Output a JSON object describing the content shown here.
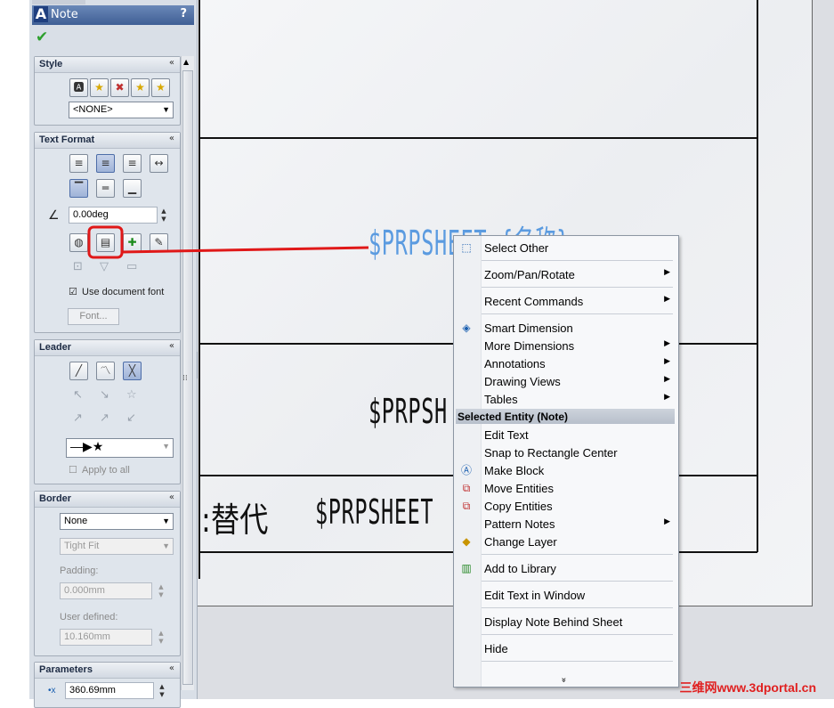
{
  "panel": {
    "title": "Note",
    "help": "?",
    "ok_glyph": "✔",
    "style": {
      "header": "Style",
      "collapse": "«",
      "select_value": "<NONE>"
    },
    "text_format": {
      "header": "Text Format",
      "collapse": "«",
      "angle_value": "0.00deg",
      "use_doc_font_label": "Use document font",
      "use_doc_font_checked": true,
      "font_button": "Font..."
    },
    "leader": {
      "header": "Leader",
      "collapse": "«",
      "apply_all_label": "Apply to all",
      "apply_all_checked": false
    },
    "border": {
      "header": "Border",
      "collapse": "«",
      "style_value": "None",
      "size_value": "Tight Fit",
      "padding_label": "Padding:",
      "padding_value": "0.000mm",
      "user_defined_label": "User defined:",
      "user_defined_value": "10.160mm"
    },
    "parameters": {
      "header": "Parameters",
      "collapse": "«",
      "x_value": "360.69mm"
    }
  },
  "drawing": {
    "note_selected": "$PRPSHEET {名称}",
    "note_mid": "$PRPSH",
    "note_bottom_left": ":替代",
    "note_bottom_right": "$PRPSHEET"
  },
  "menu": {
    "items_top": [
      {
        "label": "Select Other",
        "icon": "select-other-icon",
        "submenu": false
      },
      {
        "label": "Zoom/Pan/Rotate",
        "submenu": true
      },
      {
        "label": "Recent Commands",
        "submenu": true
      },
      {
        "label": "Smart Dimension",
        "icon": "smart-dimension-icon",
        "submenu": false
      },
      {
        "label": "More Dimensions",
        "submenu": true
      },
      {
        "label": "Annotations",
        "submenu": true
      },
      {
        "label": "Drawing Views",
        "submenu": true
      },
      {
        "label": "Tables",
        "submenu": true
      }
    ],
    "section_header": "Selected Entity (Note)",
    "items_entity": [
      {
        "label": "Edit Text",
        "submenu": false
      },
      {
        "label": "Snap to Rectangle Center",
        "submenu": false
      },
      {
        "label": "Make Block",
        "icon": "make-block-icon",
        "submenu": false
      },
      {
        "label": "Move Entities",
        "icon": "move-entities-icon",
        "submenu": false
      },
      {
        "label": "Copy Entities",
        "icon": "copy-entities-icon",
        "submenu": false
      },
      {
        "label": "Pattern Notes",
        "submenu": true
      },
      {
        "label": "Change Layer",
        "icon": "change-layer-icon",
        "submenu": false
      },
      {
        "label": "Add to Library",
        "icon": "add-to-library-icon",
        "submenu": false
      },
      {
        "label": "Edit Text in Window",
        "submenu": false
      },
      {
        "label": "Display Note Behind Sheet",
        "submenu": false
      },
      {
        "label": "Hide",
        "submenu": false
      }
    ],
    "expand_glyph": "»"
  },
  "watermark": "三维网www.3dportal.cn",
  "colors": {
    "highlight_red": "#e01818",
    "note_blue": "#5b9be0",
    "panel_bg": "#d9dfe7"
  }
}
